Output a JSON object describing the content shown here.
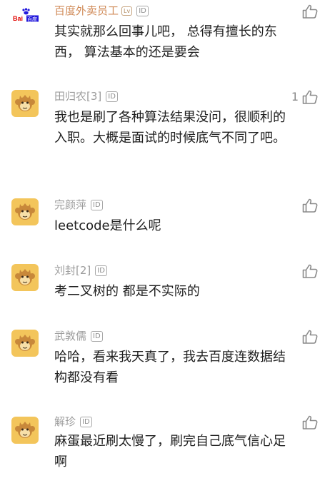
{
  "comments": [
    {
      "username": "百度外卖员工",
      "rank_badge": "Lv",
      "id_badge": "ID",
      "text": "其实就那么回事儿吧， 总得有擅长的东西， 算法基本的还是要会",
      "likes": "",
      "avatar": "baidu-logo"
    },
    {
      "username": "田归农[3]",
      "id_badge": "ID",
      "text": "我也是刷了各种算法结果没问，很顺利的入职。大概是面试的时候底气不同了吧。",
      "likes": "1",
      "avatar": "monkey"
    },
    {
      "username": "完颜萍",
      "id_badge": "ID",
      "text": "leetcode是什么呢",
      "likes": "",
      "avatar": "monkey"
    },
    {
      "username": "刘封[2]",
      "id_badge": "ID",
      "text": "考二叉树的 都是不实际的",
      "likes": "",
      "avatar": "monkey"
    },
    {
      "username": "武敦儒",
      "id_badge": "ID",
      "text": "哈哈，看来我天真了，我去百度连数据结构都没有看",
      "likes": "",
      "avatar": "monkey"
    },
    {
      "username": "解珍",
      "id_badge": "ID",
      "text": "麻蛋最近刷太慢了，刷完自己底气信心足啊",
      "likes": "",
      "avatar": "monkey"
    }
  ],
  "baidu_logo": {
    "text": "Bai",
    "subtext": "百度"
  },
  "colors": {
    "username_accent": "#d08a57",
    "username_gray": "#9c9c9c",
    "body_text": "#202020",
    "monkey_bg": "#f3c55b",
    "baidu_blue": "#2319dc",
    "baidu_red": "#e10602"
  },
  "icons": {
    "like": "thumbs-up-icon",
    "avatar": "monkey-avatar-icon"
  }
}
